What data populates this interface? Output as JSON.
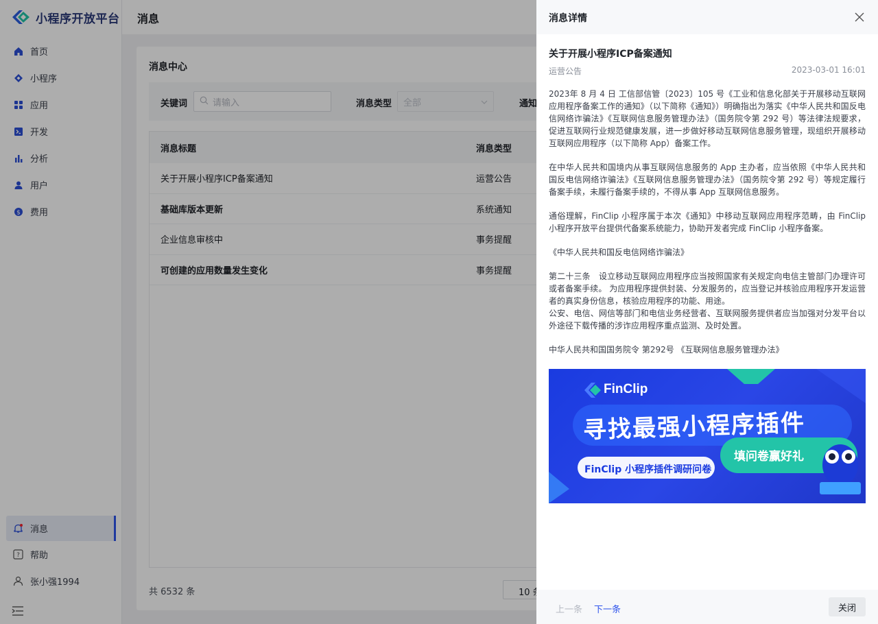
{
  "app": {
    "title": "小程序开放平台"
  },
  "sidebar": {
    "items": [
      {
        "label": "首页",
        "icon": "home-icon"
      },
      {
        "label": "小程序",
        "icon": "diamond-icon"
      },
      {
        "label": "应用",
        "icon": "apps-icon"
      },
      {
        "label": "开发",
        "icon": "terminal-icon"
      },
      {
        "label": "分析",
        "icon": "bar-chart-icon"
      },
      {
        "label": "用户",
        "icon": "user-icon"
      },
      {
        "label": "费用",
        "icon": "coin-icon"
      }
    ],
    "bottom": [
      {
        "label": "消息",
        "icon": "bell-icon"
      },
      {
        "label": "帮助",
        "icon": "help-icon"
      },
      {
        "label": "张小强1994",
        "icon": "person-icon"
      }
    ]
  },
  "header": {
    "title": "消息"
  },
  "main": {
    "panel_title": "消息中心",
    "filter": {
      "keyword_label": "关键词",
      "keyword_placeholder": "请输入",
      "type_label": "消息类型",
      "type_value": "全部",
      "notify_label": "通知"
    },
    "table": {
      "columns": [
        "消息标题",
        "消息类型"
      ],
      "rows": [
        {
          "title": "关于开展小程序ICP备案通知",
          "type": "运营公告"
        },
        {
          "title": "基础库版本更新",
          "type": "系统通知"
        },
        {
          "title": "企业信息审核中",
          "type": "事务提醒"
        },
        {
          "title": "可创建的应用数量发生变化",
          "type": "事务提醒"
        }
      ]
    },
    "total": "共 6532 条",
    "page_size": "10 条"
  },
  "drawer": {
    "title": "消息详情",
    "notice_title": "关于开展小程序ICP备案通知",
    "notice_type": "运营公告",
    "notice_time": "2023-03-01 16:01",
    "paragraphs": [
      "2023年 8 月 4 日 工信部信管〔2023〕105 号《工业和信息化部关于开展移动互联网应用程序备案工作的通知》（以下简称《通知》）明确指出为落实《中华人民共和国反电信网络诈骗法》《互联网信息服务管理办法》（国务院令第 292 号）等法律法规要求，促进互联网行业规范健康发展，进一步做好移动互联网信息服务管理，现组织开展移动互联网应用程序（以下简称 App）备案工作。",
      "在中华人民共和国境内从事互联网信息服务的 App 主办者，应当依照《中华人民共和国反电信网络诈骗法》《互联网信息服务管理办法》（国务院令第 292 号）等规定履行备案手续，未履行备案手续的，不得从事 App 互联网信息服务。",
      "通俗理解，FinClip 小程序属于本次《通知》中移动互联网应用程序范畴，由 FinClip 小程序开放平台提供代备案系统能力，协助开发者完成 FinClip 小程序备案。",
      "《中华人民共和国反电信网络诈骗法》",
      "第二十三条　设立移动互联网应用程序应当按照国家有关规定向电信主管部门办理许可或者备案手续。 为应用程序提供封装、分发服务的，应当登记并核验应用程序开发运营者的真实身份信息，核验应用程序的功能、用途。",
      "公安、电信、网信等部门和电信业务经营者、互联网服务提供者应当加强对分发平台以外途径下载传播的涉诈应用程序重点监测、及时处置。",
      "中华人民共和国国务院令 第292号 《互联网信息服务管理办法》"
    ],
    "banner": {
      "brand": "FinClip",
      "headline": "寻找最强小程序插件",
      "sub": "FinClip 小程序插件调研问卷",
      "badge": "填问卷赢好礼"
    },
    "prev_label": "上一条",
    "next_label": "下一条",
    "close_label": "关闭"
  },
  "colors": {
    "accent": "#2f54eb",
    "banner": "#1a3be0",
    "teal": "#23c4a8"
  }
}
